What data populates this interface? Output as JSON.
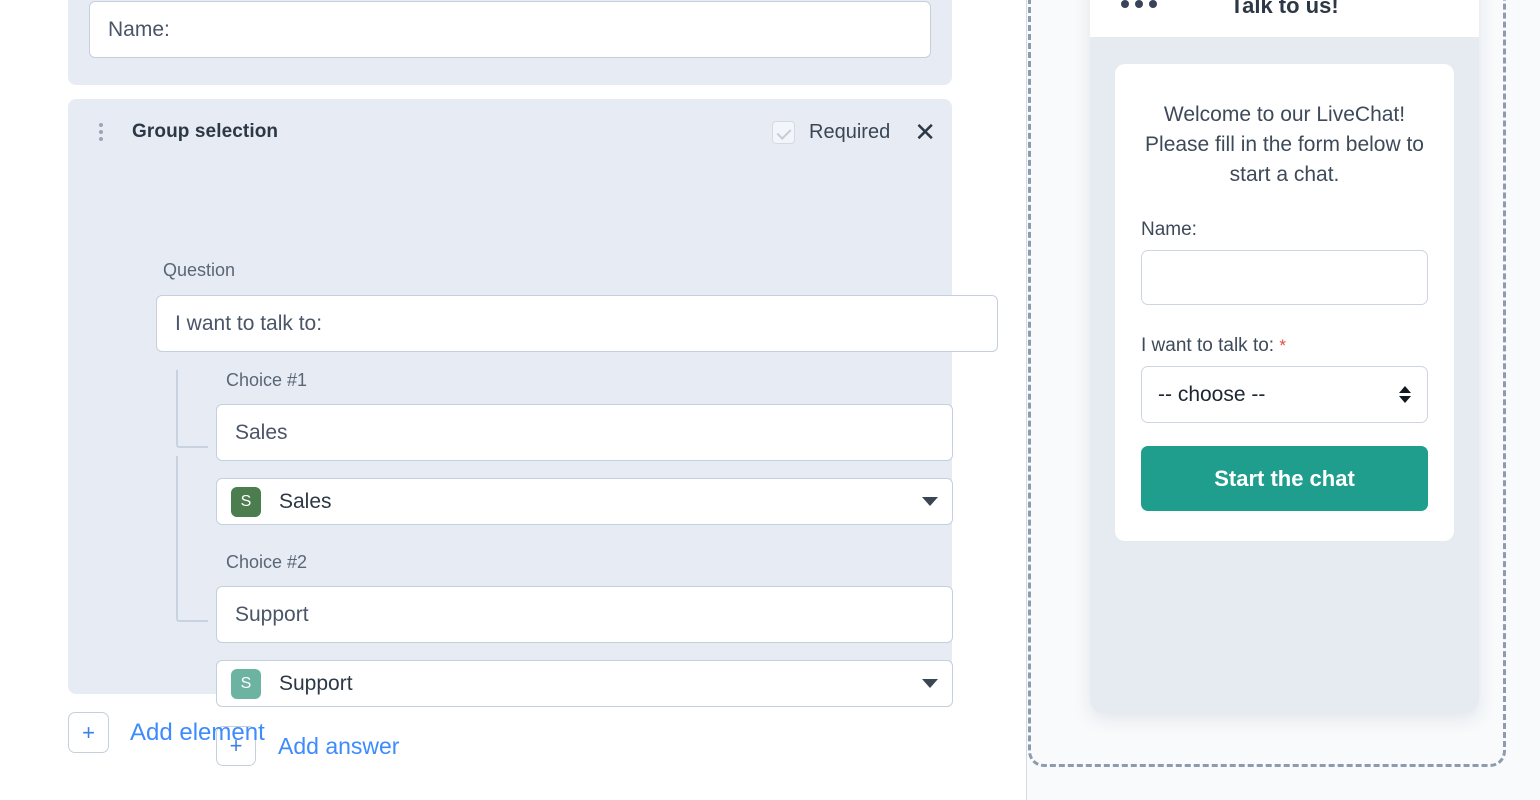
{
  "builder": {
    "name_element": {
      "value": "Name:"
    },
    "group_element": {
      "title": "Group selection",
      "required_label": "Required",
      "close_icon": "close-icon",
      "drag_icon": "drag-handle-icon",
      "question_label": "Question",
      "question_value": "I want to talk to:",
      "choices": [
        {
          "label": "Choice #1",
          "value": "Sales",
          "group_initial": "S",
          "group_name": "Sales",
          "group_color": "#4c7d4f"
        },
        {
          "label": "Choice #2",
          "value": "Support",
          "group_initial": "S",
          "group_name": "Support",
          "group_color": "#6db3a1"
        }
      ],
      "add_answer_label": "Add answer",
      "add_answer_icon": "plus-icon"
    },
    "add_element_label": "Add element",
    "add_element_icon": "plus-icon"
  },
  "preview": {
    "header_title": "Talk to us!",
    "menu_icon": "more-options-icon",
    "welcome_line1": "Welcome to our LiveChat!",
    "welcome_line2": "Please fill in the form below to",
    "welcome_line3": "start a chat.",
    "name_label": "Name:",
    "name_value": "",
    "select_label": "I want to talk to:",
    "select_required_marker": "*",
    "select_value": "-- choose --",
    "start_button_label": "Start the chat"
  },
  "colors": {
    "accent_teal": "#1f9e8e",
    "link_blue": "#3d8bfd",
    "card_bg": "#e7ecf4",
    "required_red": "#e8453c"
  }
}
